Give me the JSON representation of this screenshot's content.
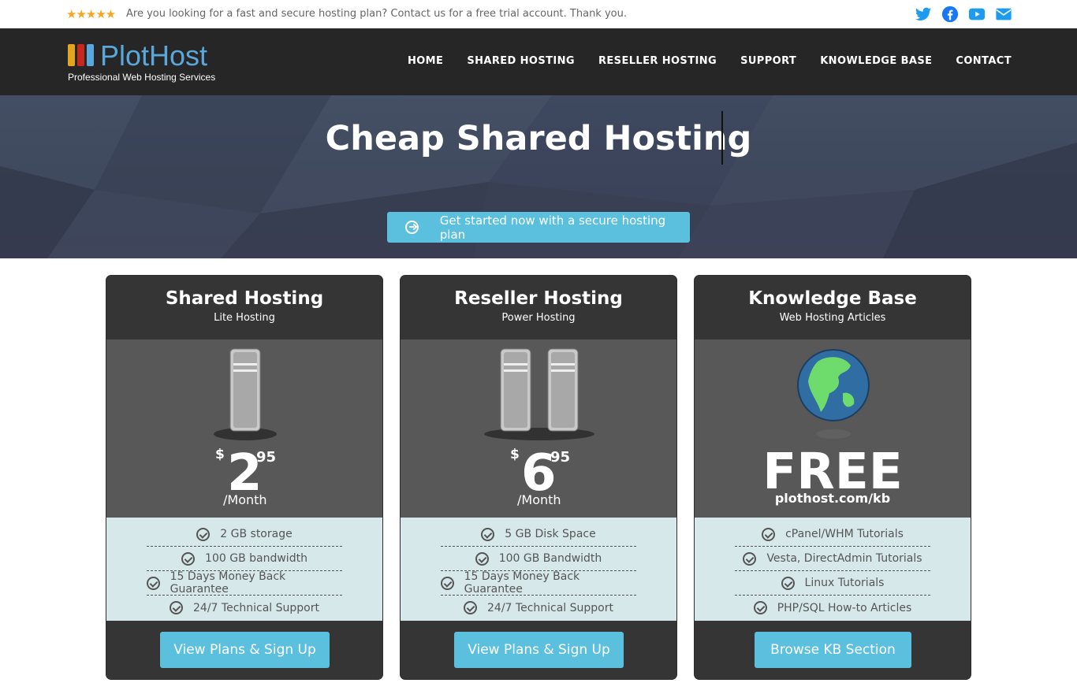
{
  "topbar": {
    "rating_icon": "five-stars-icon",
    "message": "Are you looking for a fast and secure hosting plan? Contact us for a free trial account. Thank you.",
    "social": [
      "twitter-icon",
      "facebook-icon",
      "youtube-icon",
      "envelope-icon"
    ]
  },
  "brand": {
    "name": "PlotHost",
    "tagline": "Professional Web Hosting Services",
    "accent": "#5aa7db"
  },
  "nav": {
    "items": [
      "HOME",
      "SHARED HOSTING",
      "RESELLER HOSTING",
      "SUPPORT",
      "KNOWLEDGE BASE",
      "CONTACT"
    ]
  },
  "hero": {
    "title": "Cheap Shared Hosting",
    "cta_label": "Get started now with a secure hosting plan",
    "cta_color": "#5bc0de"
  },
  "cards": [
    {
      "title": "Shared Hosting",
      "subtitle": "Lite Hosting",
      "image_icon": "server-tower-icon",
      "currency": "$",
      "price_whole": "2",
      "price_cents": "95",
      "period": "/Month",
      "features": [
        "2 GB storage",
        "100 GB bandwidth",
        "15 Days Money Back Guarantee",
        "24/7 Technical Support"
      ],
      "button": "View Plans & Sign Up"
    },
    {
      "title": "Reseller Hosting",
      "subtitle": "Power Hosting",
      "image_icon": "two-server-towers-icon",
      "currency": "$",
      "price_whole": "6",
      "price_cents": "95",
      "period": "/Month",
      "features": [
        "5 GB Disk Space",
        "100 GB Bandwidth",
        "15 Days Money Back Guarantee",
        "24/7 Technical Support"
      ],
      "button": "View Plans & Sign Up"
    },
    {
      "title": "Knowledge Base",
      "subtitle": "Web Hosting Articles",
      "image_icon": "globe-icon",
      "price_text": "FREE",
      "url": "plothost.com/kb",
      "features": [
        "cPanel/WHM Tutorials",
        "Vesta, DirectAdmin Tutorials",
        "Linux Tutorials",
        "PHP/SQL How-to Articles"
      ],
      "button": "Browse KB Section"
    }
  ]
}
